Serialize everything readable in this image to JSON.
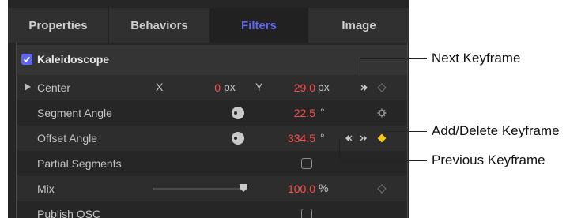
{
  "tabs": [
    {
      "label": "Properties",
      "active": false
    },
    {
      "label": "Behaviors",
      "active": false
    },
    {
      "label": "Filters",
      "active": true
    },
    {
      "label": "Image",
      "active": false
    }
  ],
  "filter": {
    "name": "Kaleidoscope",
    "enabled": true
  },
  "rows": {
    "center": {
      "label": "Center",
      "x_axis": "X",
      "x_value": "0",
      "x_unit": "px",
      "y_axis": "Y",
      "y_value": "29.0",
      "y_unit": "px"
    },
    "segment_angle": {
      "label": "Segment Angle",
      "value": "22.5",
      "unit": "°"
    },
    "offset_angle": {
      "label": "Offset Angle",
      "value": "334.5",
      "unit": "°"
    },
    "partial_segments": {
      "label": "Partial Segments",
      "checked": false
    },
    "mix": {
      "label": "Mix",
      "value": "100.0",
      "unit": "%",
      "slider_level": 1.0
    },
    "publish_osc": {
      "label": "Publish OSC",
      "checked": false
    }
  },
  "callouts": {
    "next_keyframe": "Next Keyframe",
    "add_delete_keyframe": "Add/Delete Keyframe",
    "previous_keyframe": "Previous Keyframe"
  },
  "colors": {
    "accent": "#5f67f2",
    "value_text": "#ff4d4d",
    "keyframe_active": "#f5c518",
    "panel_bg": "#262626"
  },
  "icons": [
    "checkbox-checked-icon",
    "disclosure-triangle-icon",
    "dial-icon",
    "gear-icon",
    "next-keyframe-icon",
    "previous-keyframe-icon",
    "keyframe-diamond-icon",
    "keyframe-diamond-active-icon",
    "checkbox-icon",
    "slider-thumb-icon"
  ]
}
